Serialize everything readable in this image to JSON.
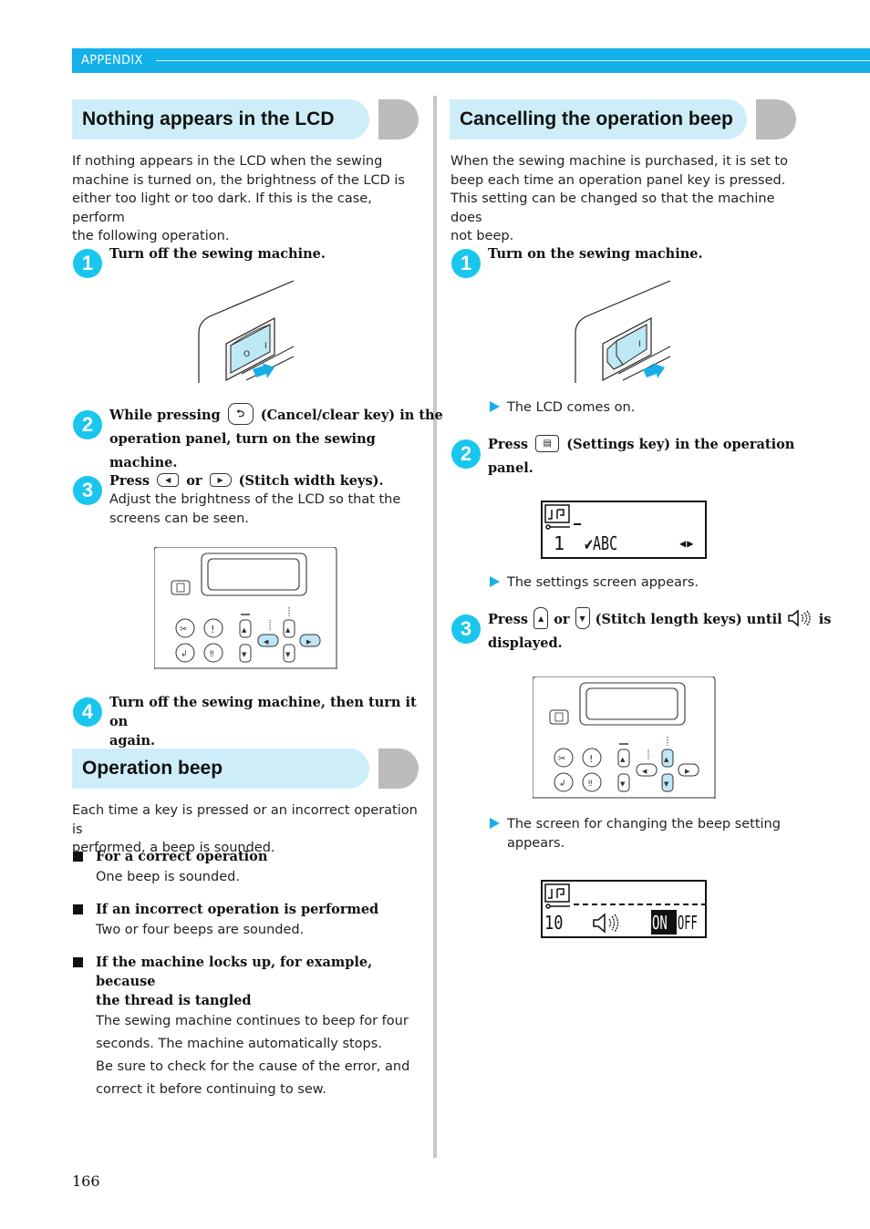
{
  "header": {
    "section_label": "APPENDIX"
  },
  "left": {
    "section1": {
      "title": "Nothing appears in the LCD",
      "intro_lines": [
        "If nothing appears in the LCD when the sewing",
        "machine is turned on, the brightness of the LCD is",
        "either too light or too dark. If this is the case, perform",
        "the following operation."
      ],
      "steps": [
        {
          "num": "1",
          "text": "Turn off the sewing machine."
        },
        {
          "num": "2",
          "text_before": "While pressing",
          "key_icon": "cancel-clear-key-icon",
          "key_glyph": "⮌",
          "text_after": "(Cancel/clear key) in the",
          "line2": "operation panel, turn on the sewing machine."
        },
        {
          "num": "3",
          "text_before": "Press",
          "key1_glyph": "◀",
          "or": "or",
          "key2_glyph": "▶",
          "text_after": "(Stitch width keys).",
          "detail_lines": [
            "Adjust the brightness of the LCD so that the",
            "screens can be seen."
          ]
        },
        {
          "num": "4",
          "line1": "Turn off the sewing machine, then turn it on",
          "line2": "again."
        }
      ],
      "switch_labels": {
        "off": "O",
        "on": "I"
      }
    },
    "section2": {
      "title": "Operation beep",
      "intro_lines": [
        "Each time a key is pressed or an incorrect operation is",
        "performed, a beep is sounded."
      ],
      "bullets": [
        {
          "title_lines": [
            "For a correct operation"
          ],
          "body_lines": [
            "One beep is sounded."
          ]
        },
        {
          "title_lines": [
            "If an incorrect operation is performed"
          ],
          "body_lines": [
            "Two or four beeps are sounded."
          ]
        },
        {
          "title_lines": [
            "If the machine locks up, for example, because",
            "the thread is tangled"
          ],
          "body_lines": [
            "The sewing machine continues to beep for four",
            "seconds. The machine automatically stops.",
            "Be sure to check for the cause of the error, and",
            "correct it before continuing to sew."
          ]
        }
      ]
    }
  },
  "right": {
    "section": {
      "title": "Cancelling the operation beep",
      "intro_lines": [
        "When the sewing machine is purchased, it is set to",
        "beep each time an operation panel key is pressed.",
        "This setting can be changed so that the machine does",
        "not beep."
      ],
      "steps": [
        {
          "num": "1",
          "text": "Turn on the sewing machine.",
          "result": "The LCD comes on."
        },
        {
          "num": "2",
          "text_before": "Press",
          "text_after": "(Settings key) in the operation",
          "line2": "panel.",
          "result": "The settings screen appears.",
          "lcd": {
            "row2_num": "1",
            "row2_label": "✔ABC",
            "row2_arrows": "◀▶"
          }
        },
        {
          "num": "3",
          "text_before": "Press",
          "key1_glyph": "▲",
          "or": "or",
          "key2_glyph": "▼",
          "text_after": "(Stitch length keys) until",
          "text_end": "is",
          "line2": "displayed.",
          "result_lines": [
            "The screen for changing the beep setting",
            "appears."
          ],
          "lcd": {
            "row2_num": "10",
            "on_label": "ON",
            "off_label": "OFF",
            "selected": "ON"
          }
        }
      ]
    }
  },
  "footer": {
    "page_number": "166"
  },
  "colors": {
    "accent": "#14b0ea",
    "step_circle": "#19c6ee",
    "heading_bg": "#cdeef9",
    "heading_cap": "#bcbcbc",
    "highlight_key": "#bfe6f6"
  }
}
